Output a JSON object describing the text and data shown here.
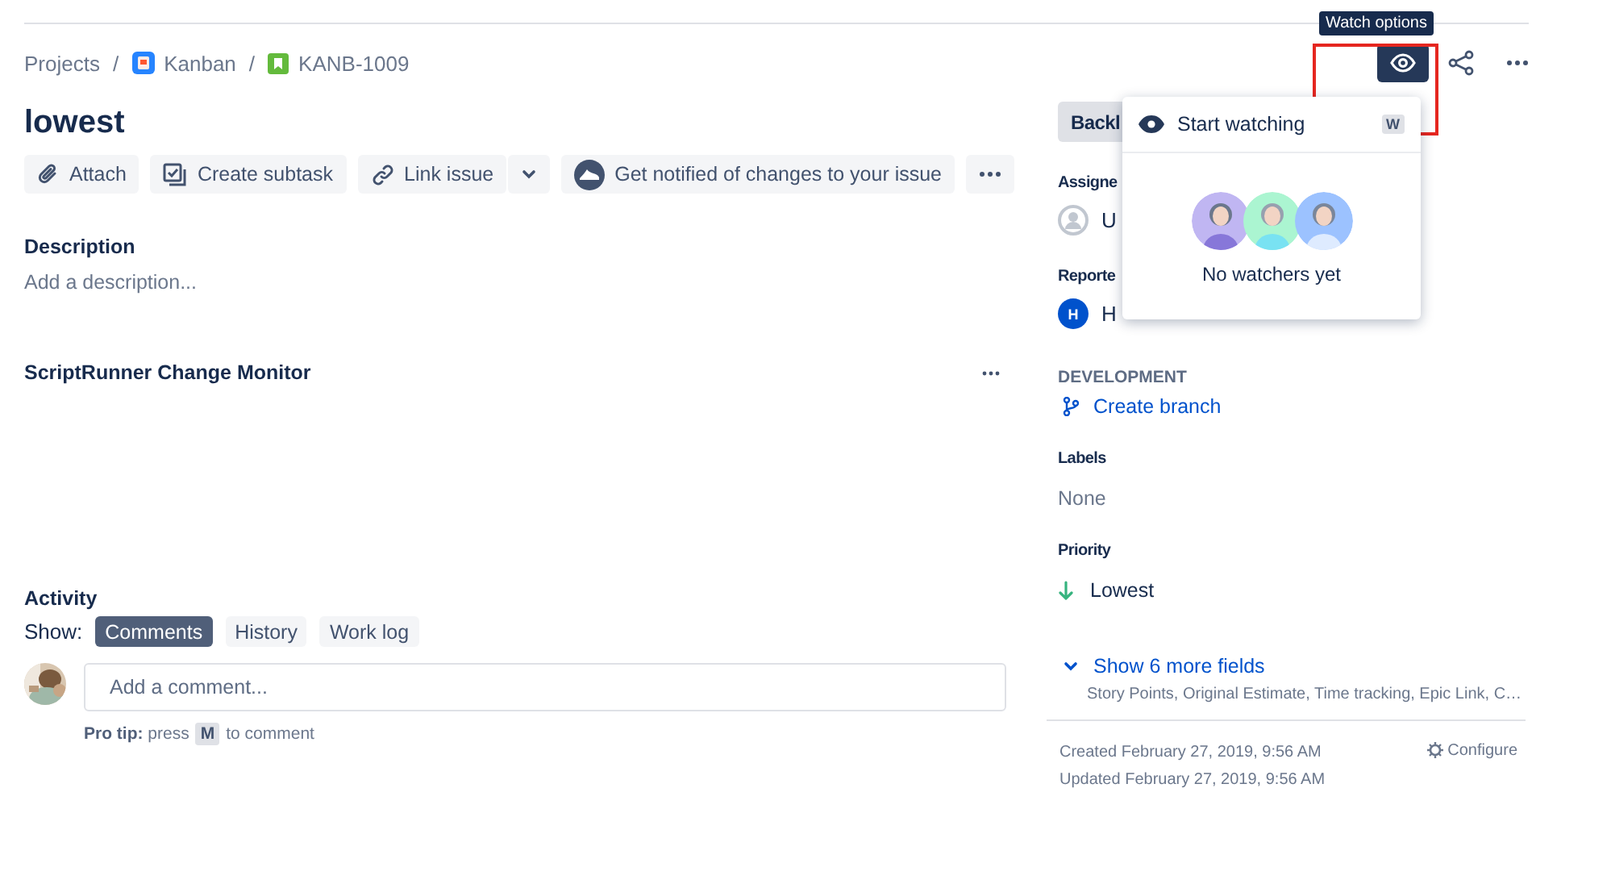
{
  "breadcrumbs": [
    {
      "text": "Projects",
      "kind": "plain"
    },
    {
      "text": "Kanban",
      "kind": "project",
      "separator": "/"
    },
    {
      "text": "KANB-1009",
      "kind": "issue",
      "separator": "/"
    }
  ],
  "title": "lowest",
  "toolbar": [
    {
      "label": "Attach",
      "kind": "attach"
    },
    {
      "label": "Create subtask",
      "kind": "subtask"
    },
    {
      "label": "Link issue",
      "kind": "link"
    },
    {
      "label": "Get notified of changes to your issue",
      "kind": "notify"
    }
  ],
  "description": {
    "label": "Description",
    "placeholder": "Add a description..."
  },
  "panel": {
    "title": "ScriptRunner Change Monitor"
  },
  "activity": {
    "heading": "Activity",
    "show_label": "Show:",
    "tabs": [
      {
        "label": "Comments",
        "selected": true
      },
      {
        "label": "History",
        "selected": false
      },
      {
        "label": "Work log",
        "selected": false
      }
    ],
    "comment_placeholder": "Add a comment...",
    "tip": "**Pro tip:** press",
    "tip_key": "M",
    "tip_end": "to comment"
  },
  "status": "Backl",
  "people": [
    {
      "label": "Assigne",
      "kind": "unassigned",
      "value": "U"
    },
    {
      "label": "Reporte",
      "kind": "initial",
      "initial": "H",
      "value": "H"
    }
  ],
  "development": {
    "label": "DEVELOPMENT",
    "link": "Create branch"
  },
  "fields": [
    {
      "label": "Labels",
      "value": "None",
      "kind": "empty"
    },
    {
      "label": "Priority",
      "value": "Lowest",
      "kind": "priority"
    }
  ],
  "more_fields": {
    "link": "Show 6 more fields",
    "summary": "Story Points, Original Estimate, Time tracking, Epic Link, C…"
  },
  "dates": [
    "Created February 27, 2019, 9:56 AM",
    "Updated February 27, 2019, 9:56 AM"
  ],
  "configure": "Configure",
  "watch": {
    "tooltip": "Watch options",
    "highlighted": true,
    "item": "Start watching",
    "shortcut": "W",
    "empty": "No watchers yet"
  }
}
